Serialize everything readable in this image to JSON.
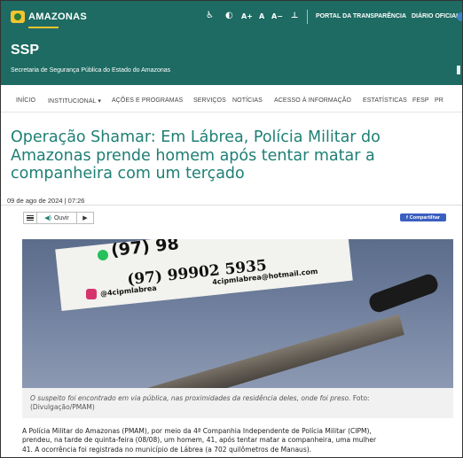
{
  "topbar": {
    "gov_name": "AMAZONAS",
    "accessibility": {
      "wheelchair": "♿",
      "contrast": "◐",
      "font_up": "A+",
      "font_default": "A",
      "font_down": "A−",
      "sitemap": "⊥"
    },
    "links": [
      "PORTAL DA TRANSPARÊNCIA",
      "DIÁRIO OFICIAL"
    ]
  },
  "header": {
    "acronym": "SSP",
    "subtitle": "Secretaria de Segurança Pública do Estado do Amazonas"
  },
  "nav": {
    "items": [
      "INÍCIO",
      "INSTITUCIONAL ▾",
      "AÇÕES E PROGRAMAS",
      "SERVIÇOS",
      "NOTÍCIAS",
      "ACESSO À INFORMAÇÃO",
      "ESTATÍSTICAS",
      "FESP",
      "PR"
    ]
  },
  "article": {
    "title_lines": [
      "Operação Shamar: Em Lábrea, Polícia Militar do",
      "Amazonas prende homem após tentar matar a",
      "companheira com um terçado"
    ],
    "date": "09 de ago de 2024 | 07:26",
    "player": {
      "listen_label": "Ouvir"
    },
    "share_label": "Compartilhar",
    "photo": {
      "sign_phone_1": "(97) 98",
      "sign_phone_2": "(97) 99902 5935",
      "sign_instagram": "@4cipmlabrea",
      "sign_email": "4cipmlabrea@hotmail.com"
    },
    "caption": {
      "italic": "O suspeito foi encontrado em via pública, nas proximidades da residência deles, onde foi preso.",
      "credit_prefix": "Foto:",
      "credit": "(Divulgação/PMAM)"
    },
    "body_lines": [
      "A Polícia Militar do Amazonas (PMAM), por meio da 4ª Companhia Independente de Polícia Militar (CIPM),",
      "prendeu, na tarde de quinta-feira (08/08), um homem, 41, após tentar matar a companheira, uma mulher",
      "41. A ocorrência foi registrada no município de Lábrea (a 702 quilômetros de Manaus)."
    ]
  },
  "colors": {
    "brand_green": "#1d6b62",
    "title_teal": "#1e7f74",
    "share_blue": "#3b5fc0",
    "accent_yellow": "#f4c430"
  }
}
